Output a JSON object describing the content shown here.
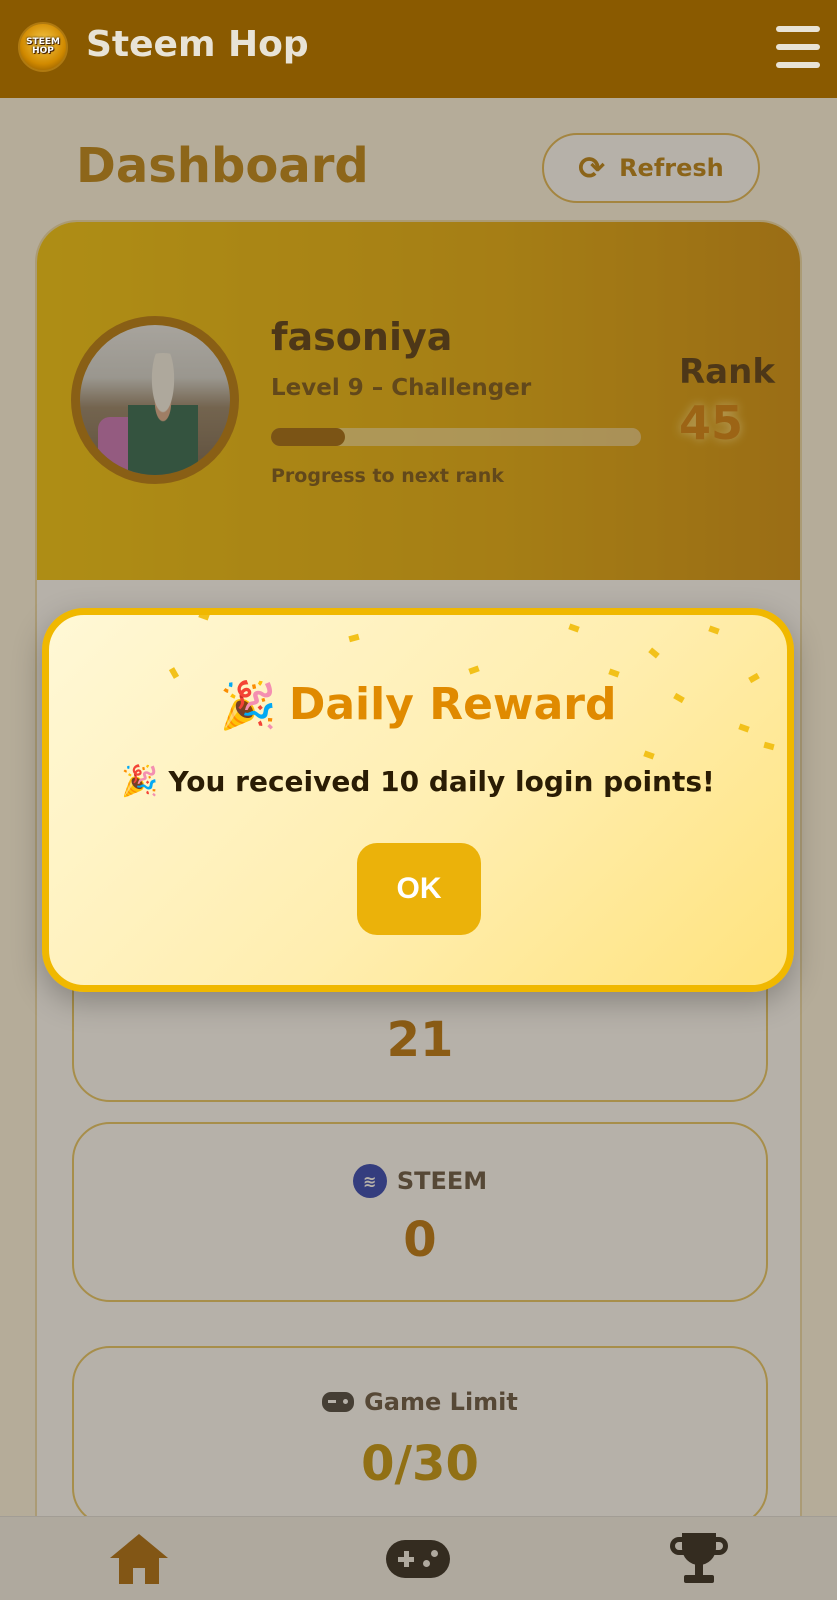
{
  "app": {
    "title": "Steem Hop",
    "logo_text": "STEEM\nHOP"
  },
  "page": {
    "title": "Dashboard",
    "refresh_label": "Refresh"
  },
  "profile": {
    "username": "fasoniya",
    "level": "Level 9 – Challenger",
    "progress_label": "Progress to next rank",
    "progress_fraction": 0.2,
    "rank_label": "Rank",
    "rank_value": "45"
  },
  "stats": {
    "partial_value": "21",
    "steem": {
      "label": "STEEM",
      "value": "0"
    },
    "game_limit": {
      "label": "Game Limit",
      "value": "0/30"
    }
  },
  "modal": {
    "title": "Daily Reward",
    "message": "You received 10 daily login points!",
    "ok_label": "OK",
    "title_emoji": "🎉",
    "message_emoji": "🎉"
  },
  "nav": {
    "items": [
      "home-icon",
      "gamepad-icon",
      "trophy-icon"
    ]
  },
  "colors": {
    "header": "#8a5a00",
    "accent": "#e3a800",
    "modal_border": "#f0b800",
    "ok_button": "#ebb20a"
  }
}
